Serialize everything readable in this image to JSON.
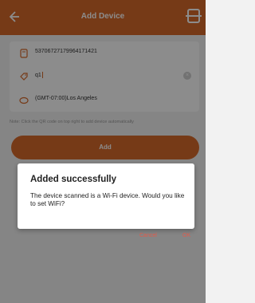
{
  "header": {
    "title": "Add Device"
  },
  "form": {
    "device_id": "53706727179964171421",
    "name_value": "q1",
    "timezone": "(GMT-07:00)Los Angeles"
  },
  "note": "Note: Click the QR code on top right to add device automatically",
  "add_button_label": "Add",
  "dialog": {
    "title": "Added successfully",
    "message": "The device scanned is a Wi-Fi device. Would you like to set WiFi?",
    "cancel_label": "Cancel",
    "ok_label": "OK"
  },
  "colors": {
    "accent": "#d86a2b",
    "dialog_button": "#e05a4a"
  }
}
